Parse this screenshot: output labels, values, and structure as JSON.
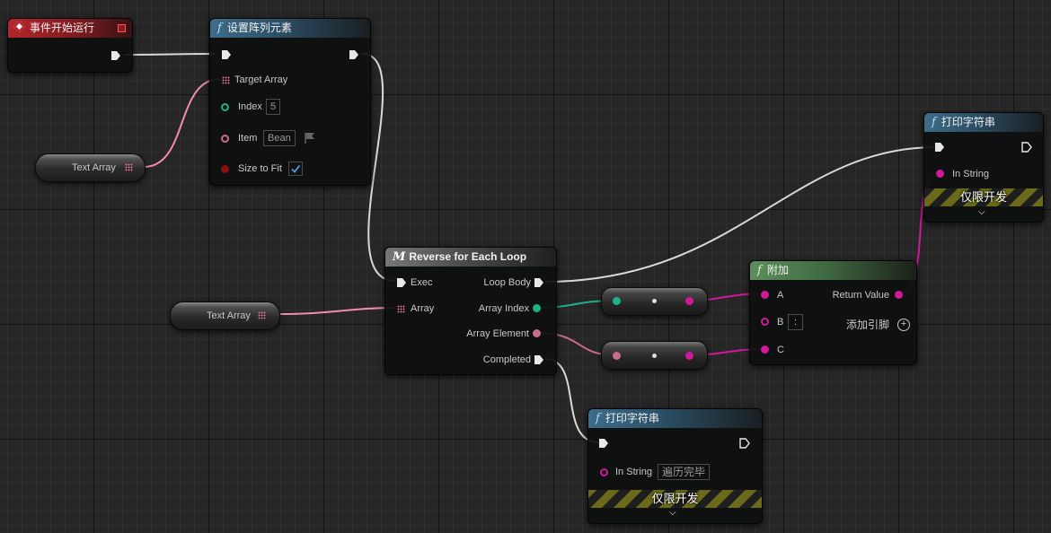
{
  "colors": {
    "exec": "#e0e0e0",
    "string": "#d1199a",
    "integer": "#1fb08a",
    "array_struct": "#e07090",
    "name": "#c86d8a",
    "bool": "#8b0f0f"
  },
  "event_node": {
    "title": "事件开始运行",
    "icon": "event-diamond-icon"
  },
  "set_array_node": {
    "title": "设置阵列元素",
    "icon": "function-icon",
    "pins": {
      "target_array": "Target Array",
      "index": "Index",
      "index_value": "5",
      "item": "Item",
      "item_value": "Bean",
      "size_to_fit": "Size to Fit"
    },
    "size_to_fit_checked": true
  },
  "var_text_array_top": {
    "label": "Text Array"
  },
  "var_text_array_mid": {
    "label": "Text Array"
  },
  "loop_node": {
    "title": "Reverse for Each Loop",
    "icon": "macro-icon",
    "pins": {
      "exec": "Exec",
      "array": "Array",
      "loop_body": "Loop Body",
      "array_index": "Array Index",
      "array_element": "Array Element",
      "completed": "Completed"
    }
  },
  "append_node": {
    "title": "附加",
    "icon": "function-icon",
    "pins": {
      "a": "A",
      "b": "B",
      "b_value": ":",
      "c": "C",
      "return_value": "Return Value",
      "add_pin": "添加引脚"
    }
  },
  "print_node_top": {
    "title": "打印字符串",
    "icon": "function-icon",
    "pins": {
      "in_string": "In String"
    },
    "dev_only": "仅限开发"
  },
  "print_node_bottom": {
    "title": "打印字符串",
    "icon": "function-icon",
    "pins": {
      "in_string": "In String",
      "in_string_value": "遍历完毕"
    },
    "dev_only": "仅限开发"
  }
}
